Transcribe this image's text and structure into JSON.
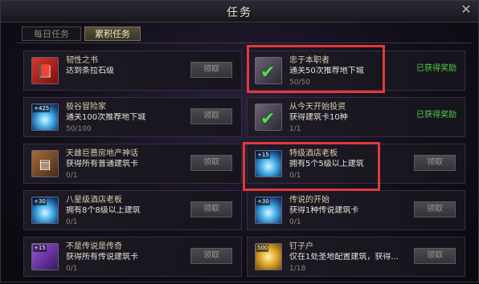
{
  "window": {
    "title": "任务"
  },
  "tabs": [
    {
      "label": "每日任务"
    },
    {
      "label": "累积任务"
    }
  ],
  "buttons": {
    "claim": "领取"
  },
  "status": {
    "completed": "已获得奖励"
  },
  "tasks": [
    {
      "name": "韧性之书",
      "desc": "达到条拉石级",
      "progress": "",
      "state": "claim",
      "icon": "red-book-icon"
    },
    {
      "name": "忠于本职者",
      "desc": "通关50次推荐地下城",
      "progress": "50/50",
      "state": "done",
      "icon": "green-check-icon"
    },
    {
      "name": "极谷冒险家",
      "desc": "通关100次推荐地下城",
      "progress": "50/100",
      "state": "claim",
      "icon": "blue-orb-icon",
      "tag": "+425"
    },
    {
      "name": "从今天开始投资",
      "desc": "获得建筑卡10种",
      "progress": "1/1",
      "state": "done",
      "icon": "green-check-icon"
    },
    {
      "name": "天雌巨蔷房地产神话",
      "desc": "获得所有普通建筑卡",
      "progress": "0/1",
      "state": "claim",
      "icon": "brown-card-icon"
    },
    {
      "name": "特级酒店老板",
      "desc": "拥有5个5级以上建筑",
      "progress": "0/1",
      "state": "claim",
      "icon": "blue-orb-icon",
      "tag": "+15"
    },
    {
      "name": "八星级酒店老板",
      "desc": "拥有8个8级以上建筑",
      "progress": "0/1",
      "state": "claim",
      "icon": "blue-orb-icon",
      "tag": "+30"
    },
    {
      "name": "传说的开始",
      "desc": "获得1种传说建筑卡",
      "progress": "0/1",
      "state": "claim",
      "icon": "blue-orb-icon",
      "tag": "+30"
    },
    {
      "name": "不是传说是传奇",
      "desc": "获得所有传说建筑卡",
      "progress": "0/1",
      "state": "claim",
      "icon": "purple-card-icon",
      "tag": "+15"
    },
    {
      "name": "钉子户",
      "desc": "仅在1处圣地配置建筑，获得...",
      "progress": "1/18",
      "state": "claim",
      "icon": "gold-coin-icon",
      "tag": "500"
    }
  ],
  "colors": {
    "highlight": "#e03a3a",
    "completed": "#4fcf4a"
  }
}
